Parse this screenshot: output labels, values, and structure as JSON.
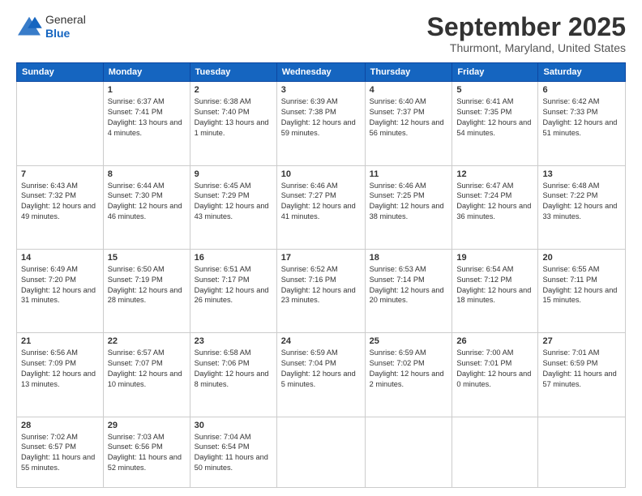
{
  "header": {
    "logo_line1": "General",
    "logo_line2": "Blue",
    "month_title": "September 2025",
    "location": "Thurmont, Maryland, United States"
  },
  "days_of_week": [
    "Sunday",
    "Monday",
    "Tuesday",
    "Wednesday",
    "Thursday",
    "Friday",
    "Saturday"
  ],
  "weeks": [
    [
      {
        "date": "",
        "sunrise": "",
        "sunset": "",
        "daylight": ""
      },
      {
        "date": "1",
        "sunrise": "Sunrise: 6:37 AM",
        "sunset": "Sunset: 7:41 PM",
        "daylight": "Daylight: 13 hours and 4 minutes."
      },
      {
        "date": "2",
        "sunrise": "Sunrise: 6:38 AM",
        "sunset": "Sunset: 7:40 PM",
        "daylight": "Daylight: 13 hours and 1 minute."
      },
      {
        "date": "3",
        "sunrise": "Sunrise: 6:39 AM",
        "sunset": "Sunset: 7:38 PM",
        "daylight": "Daylight: 12 hours and 59 minutes."
      },
      {
        "date": "4",
        "sunrise": "Sunrise: 6:40 AM",
        "sunset": "Sunset: 7:37 PM",
        "daylight": "Daylight: 12 hours and 56 minutes."
      },
      {
        "date": "5",
        "sunrise": "Sunrise: 6:41 AM",
        "sunset": "Sunset: 7:35 PM",
        "daylight": "Daylight: 12 hours and 54 minutes."
      },
      {
        "date": "6",
        "sunrise": "Sunrise: 6:42 AM",
        "sunset": "Sunset: 7:33 PM",
        "daylight": "Daylight: 12 hours and 51 minutes."
      }
    ],
    [
      {
        "date": "7",
        "sunrise": "Sunrise: 6:43 AM",
        "sunset": "Sunset: 7:32 PM",
        "daylight": "Daylight: 12 hours and 49 minutes."
      },
      {
        "date": "8",
        "sunrise": "Sunrise: 6:44 AM",
        "sunset": "Sunset: 7:30 PM",
        "daylight": "Daylight: 12 hours and 46 minutes."
      },
      {
        "date": "9",
        "sunrise": "Sunrise: 6:45 AM",
        "sunset": "Sunset: 7:29 PM",
        "daylight": "Daylight: 12 hours and 43 minutes."
      },
      {
        "date": "10",
        "sunrise": "Sunrise: 6:46 AM",
        "sunset": "Sunset: 7:27 PM",
        "daylight": "Daylight: 12 hours and 41 minutes."
      },
      {
        "date": "11",
        "sunrise": "Sunrise: 6:46 AM",
        "sunset": "Sunset: 7:25 PM",
        "daylight": "Daylight: 12 hours and 38 minutes."
      },
      {
        "date": "12",
        "sunrise": "Sunrise: 6:47 AM",
        "sunset": "Sunset: 7:24 PM",
        "daylight": "Daylight: 12 hours and 36 minutes."
      },
      {
        "date": "13",
        "sunrise": "Sunrise: 6:48 AM",
        "sunset": "Sunset: 7:22 PM",
        "daylight": "Daylight: 12 hours and 33 minutes."
      }
    ],
    [
      {
        "date": "14",
        "sunrise": "Sunrise: 6:49 AM",
        "sunset": "Sunset: 7:20 PM",
        "daylight": "Daylight: 12 hours and 31 minutes."
      },
      {
        "date": "15",
        "sunrise": "Sunrise: 6:50 AM",
        "sunset": "Sunset: 7:19 PM",
        "daylight": "Daylight: 12 hours and 28 minutes."
      },
      {
        "date": "16",
        "sunrise": "Sunrise: 6:51 AM",
        "sunset": "Sunset: 7:17 PM",
        "daylight": "Daylight: 12 hours and 26 minutes."
      },
      {
        "date": "17",
        "sunrise": "Sunrise: 6:52 AM",
        "sunset": "Sunset: 7:16 PM",
        "daylight": "Daylight: 12 hours and 23 minutes."
      },
      {
        "date": "18",
        "sunrise": "Sunrise: 6:53 AM",
        "sunset": "Sunset: 7:14 PM",
        "daylight": "Daylight: 12 hours and 20 minutes."
      },
      {
        "date": "19",
        "sunrise": "Sunrise: 6:54 AM",
        "sunset": "Sunset: 7:12 PM",
        "daylight": "Daylight: 12 hours and 18 minutes."
      },
      {
        "date": "20",
        "sunrise": "Sunrise: 6:55 AM",
        "sunset": "Sunset: 7:11 PM",
        "daylight": "Daylight: 12 hours and 15 minutes."
      }
    ],
    [
      {
        "date": "21",
        "sunrise": "Sunrise: 6:56 AM",
        "sunset": "Sunset: 7:09 PM",
        "daylight": "Daylight: 12 hours and 13 minutes."
      },
      {
        "date": "22",
        "sunrise": "Sunrise: 6:57 AM",
        "sunset": "Sunset: 7:07 PM",
        "daylight": "Daylight: 12 hours and 10 minutes."
      },
      {
        "date": "23",
        "sunrise": "Sunrise: 6:58 AM",
        "sunset": "Sunset: 7:06 PM",
        "daylight": "Daylight: 12 hours and 8 minutes."
      },
      {
        "date": "24",
        "sunrise": "Sunrise: 6:59 AM",
        "sunset": "Sunset: 7:04 PM",
        "daylight": "Daylight: 12 hours and 5 minutes."
      },
      {
        "date": "25",
        "sunrise": "Sunrise: 6:59 AM",
        "sunset": "Sunset: 7:02 PM",
        "daylight": "Daylight: 12 hours and 2 minutes."
      },
      {
        "date": "26",
        "sunrise": "Sunrise: 7:00 AM",
        "sunset": "Sunset: 7:01 PM",
        "daylight": "Daylight: 12 hours and 0 minutes."
      },
      {
        "date": "27",
        "sunrise": "Sunrise: 7:01 AM",
        "sunset": "Sunset: 6:59 PM",
        "daylight": "Daylight: 11 hours and 57 minutes."
      }
    ],
    [
      {
        "date": "28",
        "sunrise": "Sunrise: 7:02 AM",
        "sunset": "Sunset: 6:57 PM",
        "daylight": "Daylight: 11 hours and 55 minutes."
      },
      {
        "date": "29",
        "sunrise": "Sunrise: 7:03 AM",
        "sunset": "Sunset: 6:56 PM",
        "daylight": "Daylight: 11 hours and 52 minutes."
      },
      {
        "date": "30",
        "sunrise": "Sunrise: 7:04 AM",
        "sunset": "Sunset: 6:54 PM",
        "daylight": "Daylight: 11 hours and 50 minutes."
      },
      {
        "date": "",
        "sunrise": "",
        "sunset": "",
        "daylight": ""
      },
      {
        "date": "",
        "sunrise": "",
        "sunset": "",
        "daylight": ""
      },
      {
        "date": "",
        "sunrise": "",
        "sunset": "",
        "daylight": ""
      },
      {
        "date": "",
        "sunrise": "",
        "sunset": "",
        "daylight": ""
      }
    ]
  ]
}
